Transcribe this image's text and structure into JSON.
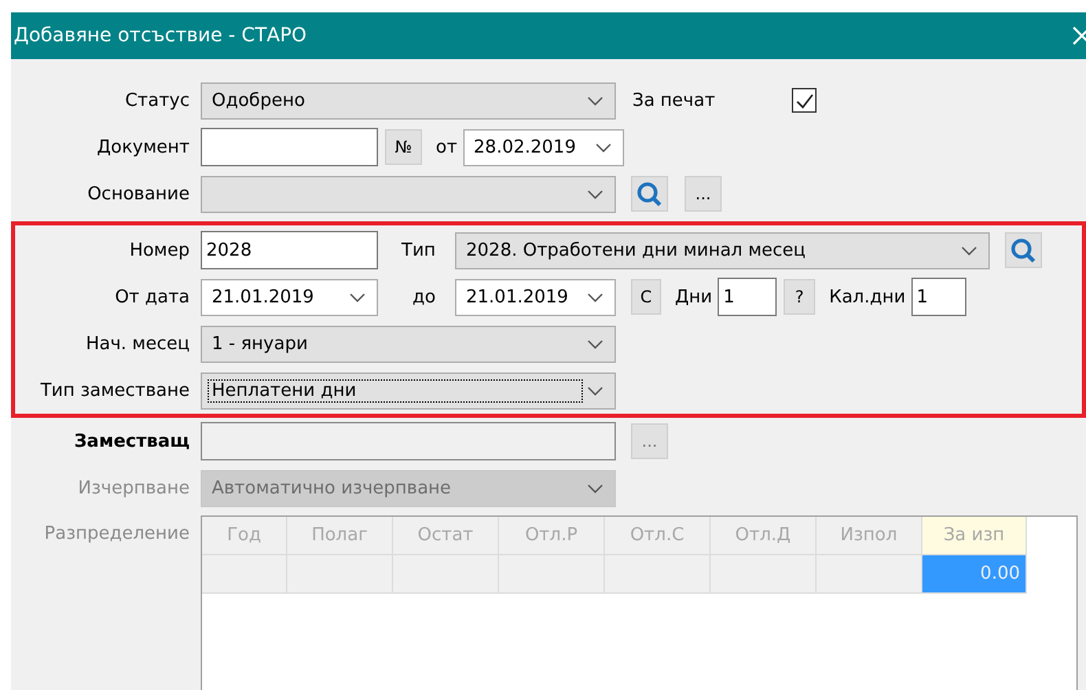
{
  "window": {
    "title": "Добавяне отсъствие - СТАРО"
  },
  "status": {
    "label": "Статус",
    "value": "Одобрено",
    "print_label": "За печат",
    "print_checked": true
  },
  "document": {
    "label": "Документ",
    "number_button": "№",
    "date_label": "от",
    "date": "28.02.2019"
  },
  "basis": {
    "label": "Основание",
    "more_button": "..."
  },
  "highlighted": true,
  "number": {
    "label": "Номер",
    "value": "2028",
    "type_label": "Тип",
    "type_value": "2028. Отработени дни минал месец"
  },
  "period": {
    "from_label": "От дата",
    "from": "21.01.2019",
    "to_label": "до",
    "to": "21.01.2019",
    "c_button": "C",
    "days_label": "Дни",
    "days": "1",
    "help_button": "?",
    "cal_days_label": "Кал.дни",
    "cal_days": "1"
  },
  "start_month": {
    "label": "Нач. месец",
    "value": "1 - януари"
  },
  "substitution_type": {
    "label": "Тип заместване",
    "value": "Неплатени дни",
    "focused": true
  },
  "substitute": {
    "label": "Заместващ",
    "more_button": "..."
  },
  "depletion": {
    "label": "Изчерпване",
    "value": "Автоматично изчерпване",
    "disabled": true
  },
  "distribution": {
    "label": "Разпределение",
    "disabled": true,
    "columns": [
      {
        "label": "Год",
        "highlighted": false
      },
      {
        "label": "Полаг",
        "highlighted": false
      },
      {
        "label": "Остат",
        "highlighted": false
      },
      {
        "label": "Отл.Р",
        "highlighted": false
      },
      {
        "label": "Отл.С",
        "highlighted": false
      },
      {
        "label": "Отл.Д",
        "highlighted": false
      },
      {
        "label": "Изпол",
        "highlighted": false
      },
      {
        "label": "За изп",
        "highlighted": true
      }
    ],
    "rows": [
      {
        "cells": [
          {
            "selected": false
          },
          {
            "selected": false
          },
          {
            "selected": false
          },
          {
            "selected": false
          },
          {
            "selected": false
          },
          {
            "selected": false
          },
          {
            "selected": false
          },
          {
            "text": "0.00",
            "selected": true
          }
        ]
      }
    ]
  }
}
